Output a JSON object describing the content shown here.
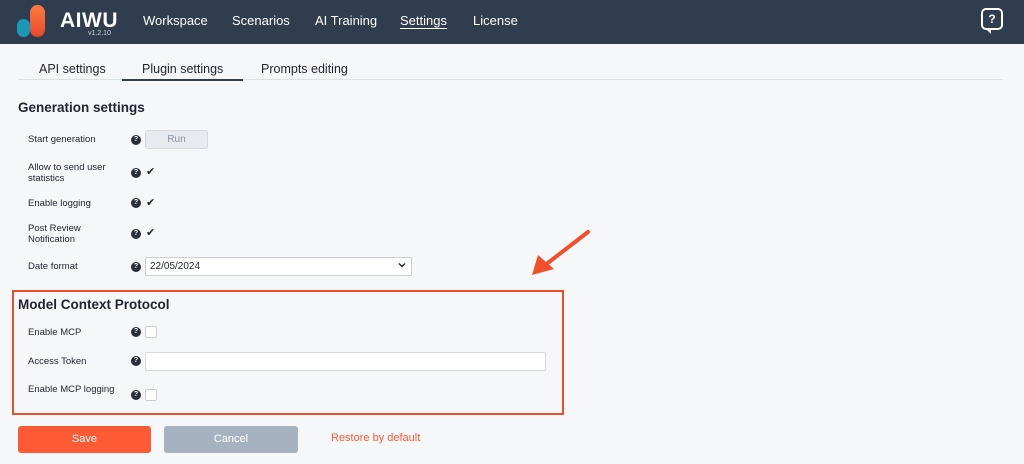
{
  "app": {
    "brand": "AIWU",
    "version": "v1.2.10"
  },
  "nav": {
    "items": [
      {
        "label": "Workspace"
      },
      {
        "label": "Scenarios"
      },
      {
        "label": "AI Training"
      },
      {
        "label": "Settings",
        "active": true
      },
      {
        "label": "License"
      }
    ],
    "help_symbol": "?"
  },
  "tabs": [
    {
      "label": "API settings"
    },
    {
      "label": "Plugin settings",
      "active": true
    },
    {
      "label": "Prompts editing"
    }
  ],
  "generation": {
    "title": "Generation settings",
    "start_generation": {
      "label": "Start generation",
      "button": "Run"
    },
    "allow_stats": {
      "label": "Allow to send user statistics",
      "checked": true
    },
    "enable_logging": {
      "label": "Enable logging",
      "checked": true
    },
    "post_review": {
      "label": "Post Review Notification",
      "checked": true
    },
    "date_format": {
      "label": "Date format",
      "value": "22/05/2024"
    }
  },
  "mcp": {
    "title": "Model Context Protocol",
    "enable_mcp": {
      "label": "Enable MCP",
      "checked": false
    },
    "access_token": {
      "label": "Access Token",
      "value": ""
    },
    "enable_mcp_logging": {
      "label": "Enable MCP logging",
      "checked": false
    }
  },
  "actions": {
    "save": "Save",
    "cancel": "Cancel",
    "restore": "Restore by default"
  },
  "icons": {
    "hint": "question-circle-icon",
    "check": "checkmark-icon",
    "select": "chevron-down-icon",
    "annotation": "red-arrow-icon"
  },
  "colors": {
    "topbar": "#2f3d4e",
    "accent": "#ff5a36",
    "highlight": "#e8502f",
    "cancel": "#a7b2c1"
  }
}
